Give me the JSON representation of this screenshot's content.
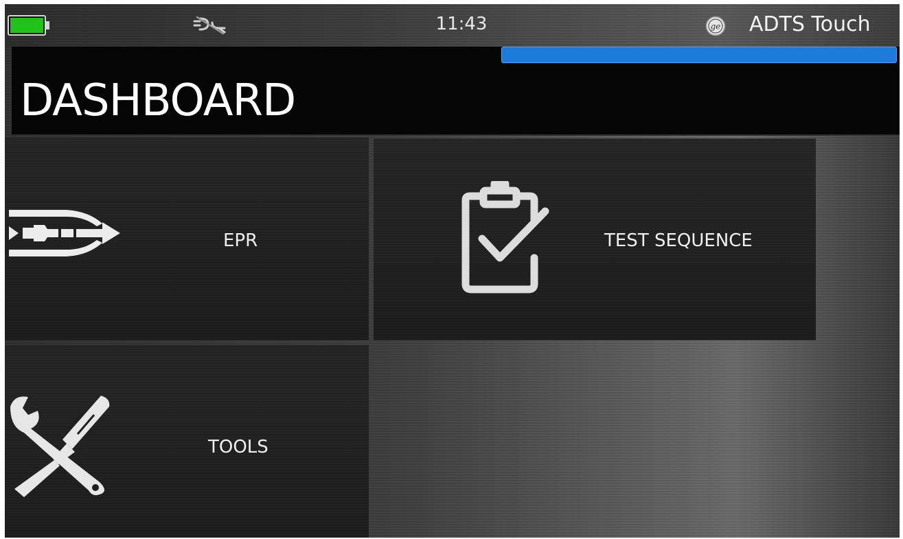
{
  "status_bar": {
    "battery_icon": "battery-icon",
    "battery_level": 1.0,
    "battery_color": "#22c21b",
    "connection_icon": "disconnected-plug-icon",
    "time": "11:43",
    "brand_icon": "ge-logo-icon",
    "device_name": "ADTS Touch"
  },
  "header": {
    "title": "DASHBOARD",
    "progress_color": "#1c7bd8"
  },
  "tiles": [
    {
      "label": "EPR",
      "icon": "engine-pressure-ratio-icon"
    },
    {
      "label": "TEST SEQUENCE",
      "icon": "clipboard-check-icon"
    },
    {
      "label": "TOOLS",
      "icon": "wrench-screwdriver-icon"
    }
  ]
}
